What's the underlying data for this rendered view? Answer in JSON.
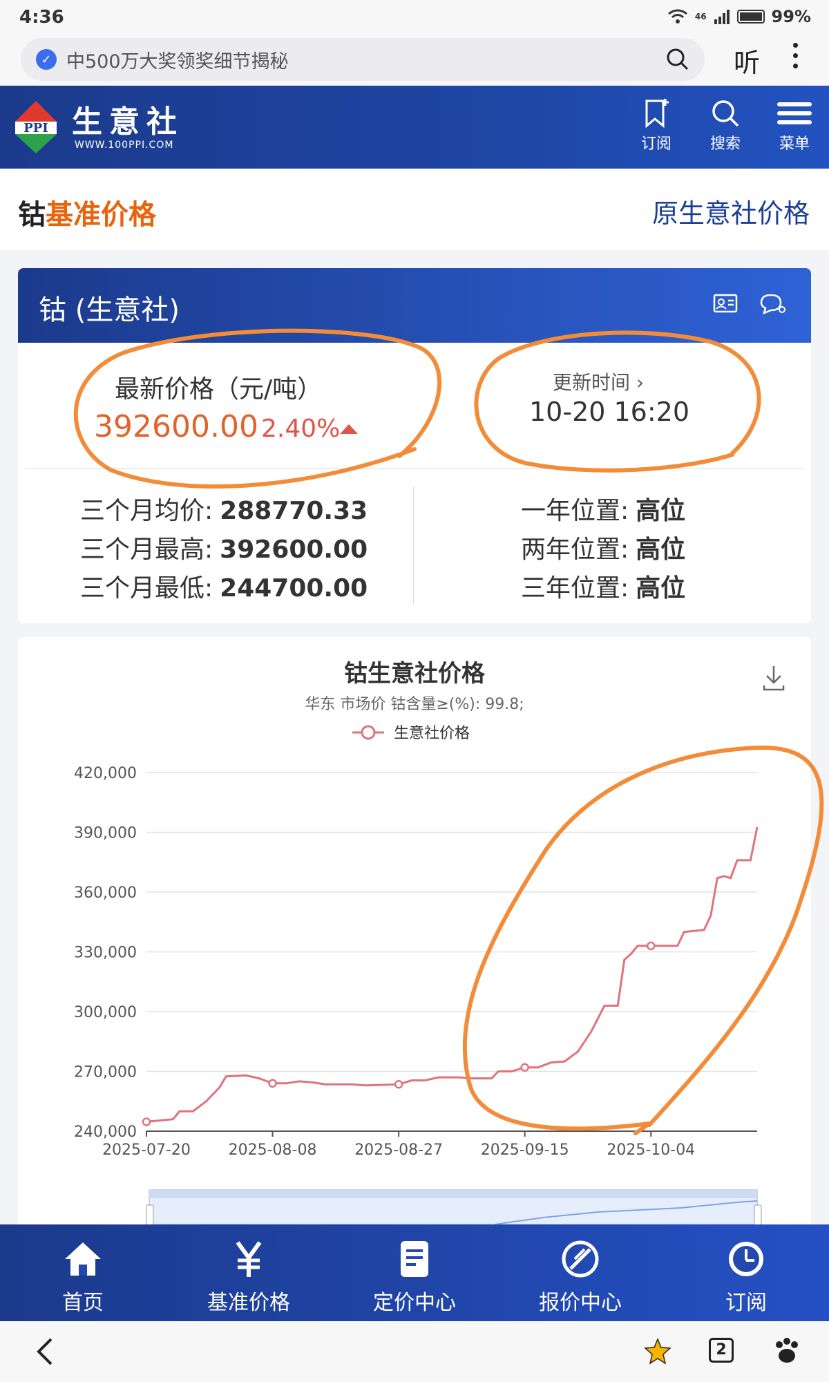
{
  "status": {
    "time": "4:36",
    "network": "46",
    "battery": "99%"
  },
  "browser": {
    "address": "中500万大奖领奖细节揭秘",
    "listen": "听"
  },
  "site": {
    "name": "生意社",
    "domain": "WWW.100PPI.COM",
    "logo_letters": "PPI",
    "actions": [
      {
        "label": "订阅",
        "icon": "bookmark-icon"
      },
      {
        "label": "搜索",
        "icon": "search-icon"
      },
      {
        "label": "菜单",
        "icon": "menu-icon"
      }
    ]
  },
  "page": {
    "title_prefix": "钴",
    "title_highlight": "基准价格",
    "original_link": "原生意社价格"
  },
  "price_card": {
    "title": "钴 (生意社)",
    "price_label": "最新价格（元/吨）",
    "price": "392600.00",
    "change": "2.40%",
    "update_label": "更新时间",
    "update_time": "10-20 16:20",
    "stats_left": [
      {
        "label": "三个月均价:",
        "value": "288770.33"
      },
      {
        "label": "三个月最高:",
        "value": "392600.00"
      },
      {
        "label": "三个月最低:",
        "value": "244700.00"
      }
    ],
    "stats_right": [
      {
        "label": "一年位置:",
        "value": "高位"
      },
      {
        "label": "两年位置:",
        "value": "高位"
      },
      {
        "label": "三年位置:",
        "value": "高位"
      }
    ]
  },
  "chart_data": {
    "type": "line",
    "title": "钴生意社价格",
    "subtitle": "华东 市场价 钴含量≥(%): 99.8;",
    "series": [
      {
        "name": "生意社价格",
        "color": "#e0727a",
        "points": [
          [
            "2025-07-20",
            244700
          ],
          [
            "2025-07-24",
            246000
          ],
          [
            "2025-07-25",
            250000
          ],
          [
            "2025-07-27",
            250000
          ],
          [
            "2025-07-29",
            255000
          ],
          [
            "2025-07-31",
            262000
          ],
          [
            "2025-08-01",
            267500
          ],
          [
            "2025-08-04",
            268000
          ],
          [
            "2025-08-06",
            266500
          ],
          [
            "2025-08-08",
            264000
          ],
          [
            "2025-08-10",
            264000
          ],
          [
            "2025-08-12",
            265000
          ],
          [
            "2025-08-14",
            264500
          ],
          [
            "2025-08-16",
            263500
          ],
          [
            "2025-08-20",
            263500
          ],
          [
            "2025-08-22",
            263000
          ],
          [
            "2025-08-27",
            263500
          ],
          [
            "2025-08-29",
            265500
          ],
          [
            "2025-08-31",
            265500
          ],
          [
            "2025-09-02",
            267000
          ],
          [
            "2025-09-05",
            267000
          ],
          [
            "2025-09-07",
            266500
          ],
          [
            "2025-09-10",
            266500
          ],
          [
            "2025-09-11",
            270000
          ],
          [
            "2025-09-13",
            270000
          ],
          [
            "2025-09-15",
            272000
          ],
          [
            "2025-09-17",
            272000
          ],
          [
            "2025-09-19",
            274500
          ],
          [
            "2025-09-21",
            275000
          ],
          [
            "2025-09-23",
            280000
          ],
          [
            "2025-09-25",
            290000
          ],
          [
            "2025-09-27",
            303000
          ],
          [
            "2025-09-29",
            303000
          ],
          [
            "2025-09-30",
            326000
          ],
          [
            "2025-10-01",
            329000
          ],
          [
            "2025-10-02",
            333000
          ],
          [
            "2025-10-04",
            333000
          ],
          [
            "2025-10-08",
            333000
          ],
          [
            "2025-10-09",
            340000
          ],
          [
            "2025-10-12",
            341000
          ],
          [
            "2025-10-13",
            348000
          ],
          [
            "2025-10-14",
            367000
          ],
          [
            "2025-10-15",
            368000
          ],
          [
            "2025-10-16",
            367000
          ],
          [
            "2025-10-17",
            376000
          ],
          [
            "2025-10-19",
            376000
          ],
          [
            "2025-10-20",
            392600
          ]
        ]
      }
    ],
    "markers": [
      "2025-07-20",
      "2025-08-08",
      "2025-08-27",
      "2025-09-15",
      "2025-10-04"
    ],
    "x_ticks": [
      "2025-07-20",
      "2025-08-08",
      "2025-08-27",
      "2025-09-15",
      "2025-10-04"
    ],
    "y_ticks": [
      "240,000",
      "270,000",
      "300,000",
      "330,000",
      "360,000",
      "390,000",
      "420,000"
    ],
    "ylim": [
      240000,
      420000
    ],
    "xlim": [
      "2025-07-20",
      "2025-10-20"
    ],
    "grid": true,
    "legend": "top-center"
  },
  "bottom_nav": [
    {
      "label": "首页",
      "icon": "home-icon"
    },
    {
      "label": "基准价格",
      "icon": "yen-icon"
    },
    {
      "label": "定价中心",
      "icon": "document-icon"
    },
    {
      "label": "报价中心",
      "icon": "quote-icon"
    },
    {
      "label": "订阅",
      "icon": "clock-icon"
    }
  ],
  "system_bar": {
    "tab_count": "2"
  },
  "colors": {
    "brand_blue": "#1b3a8c",
    "price_orange": "#e0642a",
    "up_red": "#e0554a",
    "annotation_orange": "#f28c38"
  }
}
